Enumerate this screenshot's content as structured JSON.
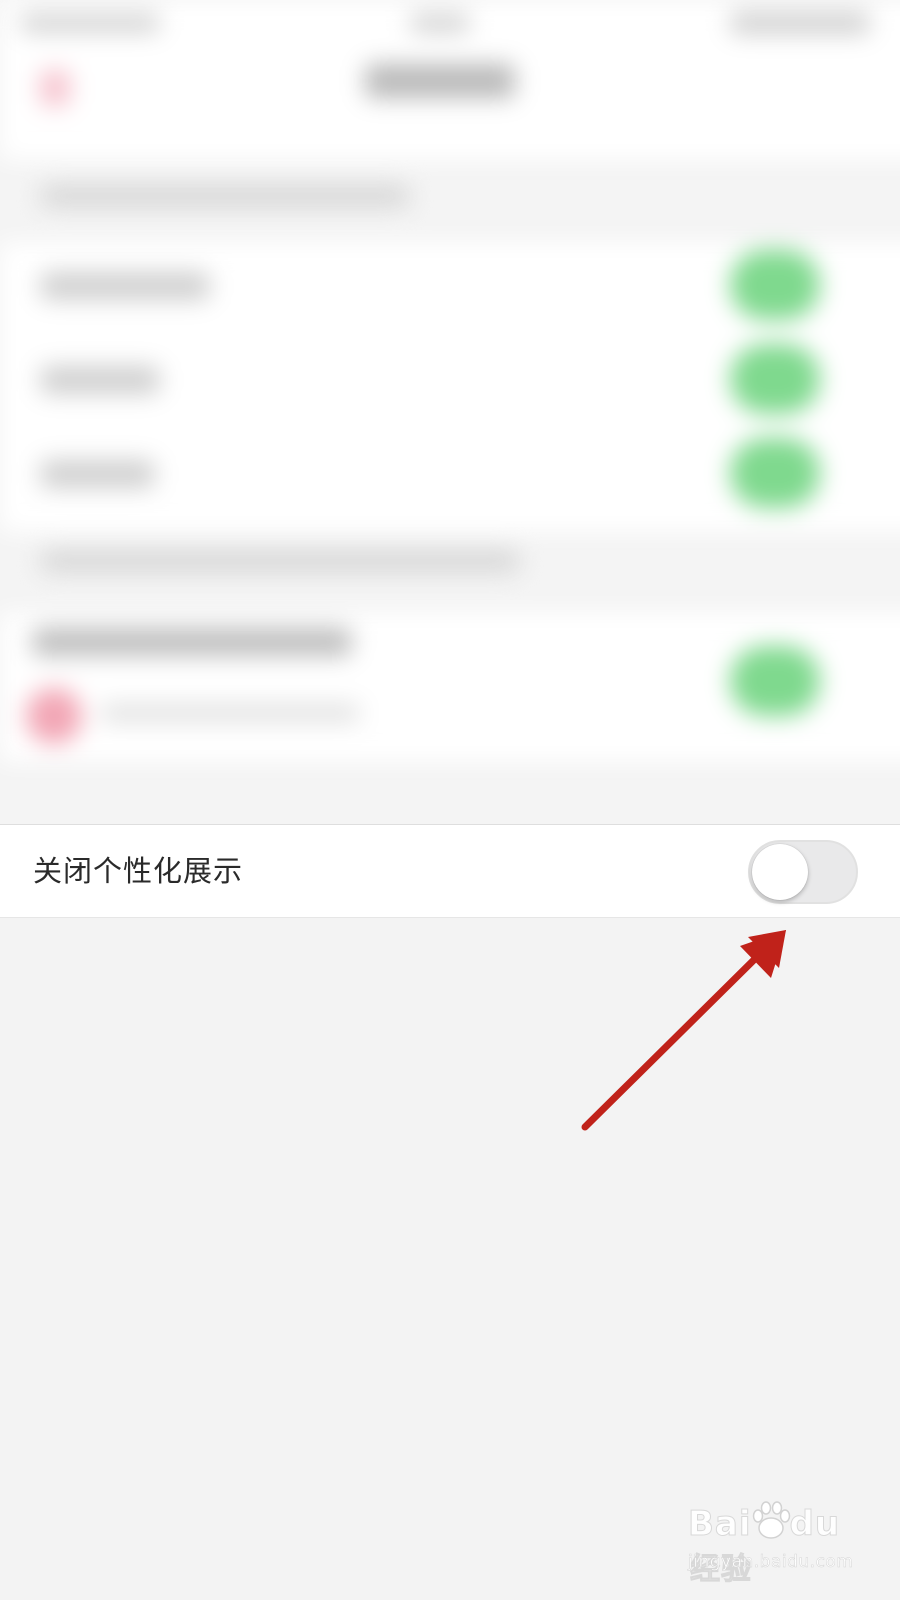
{
  "setting": {
    "label": "关闭个性化展示",
    "toggle_on": false
  },
  "watermark": {
    "brand_left": "Bai",
    "brand_right": "du",
    "brand_cn": "经验",
    "sub": "jingyan.baidu.com"
  },
  "colors": {
    "toggle_off_track": "#e9e9ea",
    "toggle_on_blurred": "#7fd98e",
    "arrow": "#c0221a"
  },
  "icons": {
    "annotation": "red-arrow-icon",
    "watermark": "baidu-paw-logo"
  }
}
